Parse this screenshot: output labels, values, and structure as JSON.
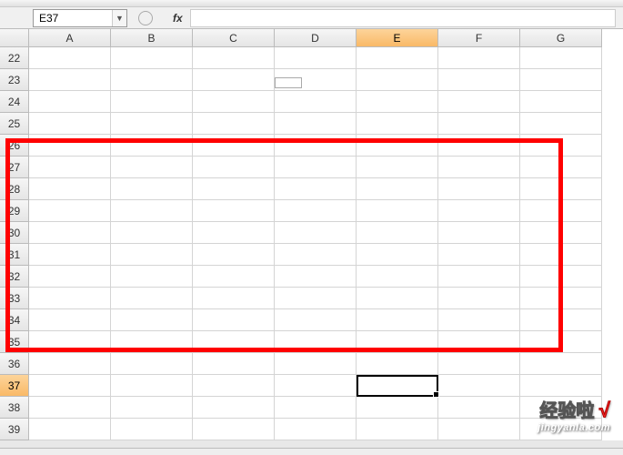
{
  "name_box": {
    "value": "E37",
    "dropdown_glyph": "▼"
  },
  "formula_bar": {
    "fx_label": "fx",
    "value": ""
  },
  "columns": [
    "A",
    "B",
    "C",
    "D",
    "E",
    "F",
    "G"
  ],
  "rows": [
    22,
    23,
    24,
    25,
    26,
    27,
    28,
    29,
    30,
    31,
    32,
    33,
    34,
    35,
    36,
    37,
    38,
    39
  ],
  "selected_column": "E",
  "selected_row": 37,
  "watermark": {
    "title": "经验啦",
    "check": "√",
    "subtitle": "jingyanla.com"
  }
}
